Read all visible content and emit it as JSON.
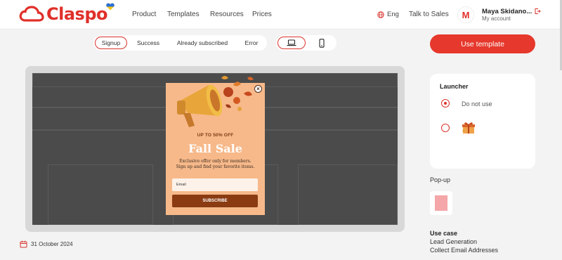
{
  "brand": {
    "name": "Claspo",
    "accent": "#e0302a"
  },
  "nav": {
    "items": [
      "Product",
      "Templates",
      "Resources",
      "Prices"
    ]
  },
  "header": {
    "language": "Eng",
    "talk_to_sales": "Talk to Sales",
    "avatar_letter": "M",
    "user_name": "Maya Skidano...",
    "account_label": "My account"
  },
  "tabs": {
    "items": [
      "Signup",
      "Success",
      "Already subscribed",
      "Error"
    ],
    "active": "Signup"
  },
  "devices": {
    "items": [
      "desktop-icon",
      "mobile-icon"
    ],
    "active": "desktop-icon"
  },
  "actions": {
    "use_template": "Use template"
  },
  "popup": {
    "pre_title": "UP TO 50% OFF",
    "title": "Fall Sale",
    "desc_line1": "Exclusive offer only for members.",
    "desc_line2": "Sign up and find your favorite items.",
    "email_placeholder": "Email",
    "button": "SUBSCRIBE",
    "background": "#f7b98a",
    "button_color": "#8a3b12"
  },
  "meta": {
    "date": "31 October 2024"
  },
  "launcher": {
    "title": "Launcher",
    "options": [
      {
        "label": "Do not use",
        "checked": true
      },
      {
        "label": "",
        "icon": "gift-box-icon",
        "checked": false
      }
    ]
  },
  "popup_section": {
    "label": "Pop-up"
  },
  "use_case": {
    "title": "Use case",
    "items": [
      "Lead Generation",
      "Collect Email Addresses"
    ]
  }
}
